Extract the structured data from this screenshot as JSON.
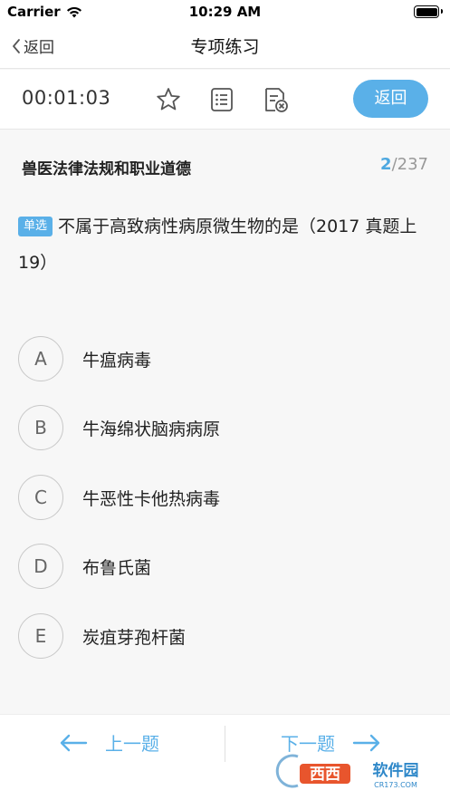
{
  "status_bar": {
    "carrier": "Carrier",
    "time": "10:29 AM"
  },
  "nav": {
    "back_label": "返回",
    "title": "专项练习"
  },
  "toolbar": {
    "timer": "00:01:03",
    "icons": [
      "star-icon",
      "list-icon",
      "clear-record-icon"
    ],
    "return_label": "返回"
  },
  "question": {
    "subject": "兽医法律法规和职业道德",
    "current": "2",
    "total": "/237",
    "type_tag": "单选",
    "text": "不属于高致病性病原微生物的是（2017 真题上 19）"
  },
  "options": [
    {
      "letter": "A",
      "text": "牛瘟病毒"
    },
    {
      "letter": "B",
      "text": "牛海绵状脑病病原"
    },
    {
      "letter": "C",
      "text": "牛恶性卡他热病毒"
    },
    {
      "letter": "D",
      "text": "布鲁氏菌"
    },
    {
      "letter": "E",
      "text": "炭疽芽孢杆菌"
    }
  ],
  "bottom": {
    "prev_label": "上一题",
    "next_label": "下一题"
  },
  "watermark": {
    "text": "西西软件园",
    "url_text": "CR173.COM"
  },
  "colors": {
    "accent": "#5ab0e8",
    "background": "#f7f7f7"
  }
}
